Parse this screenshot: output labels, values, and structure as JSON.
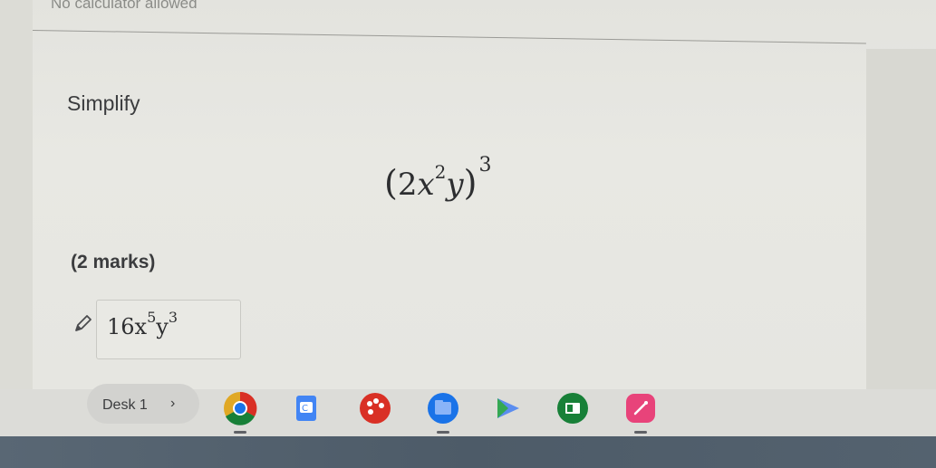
{
  "page": {
    "notice": "No calculator allowed",
    "prompt": "Simplify",
    "expression": {
      "open_paren": "(",
      "coefficient": "2",
      "var1": "x",
      "var1_exp": "2",
      "var2": "y",
      "close_paren": ")",
      "outer_exp": "3"
    },
    "marks": "(2 marks)",
    "answer": {
      "coefficient": "16",
      "var1": "x",
      "var1_exp": "5",
      "var2": "y",
      "var2_exp": "3"
    }
  },
  "taskbar": {
    "desk_label": "Desk 1",
    "chevron": "›",
    "apps": [
      {
        "icon": "chrome-icon",
        "color": "#1a73e8"
      },
      {
        "icon": "docs-icon",
        "color": "#4285f4"
      },
      {
        "icon": "palette-icon",
        "color": "#d93025"
      },
      {
        "icon": "files-icon",
        "color": "#1a73e8"
      },
      {
        "icon": "play-icon",
        "color": "#5b8def"
      },
      {
        "icon": "classroom-icon",
        "color": "#188038"
      },
      {
        "icon": "canvas-icon",
        "color": "#e8437a"
      }
    ]
  }
}
